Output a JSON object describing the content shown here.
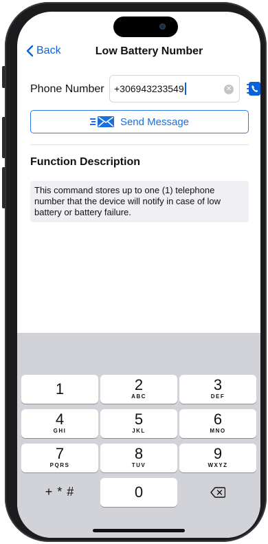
{
  "nav": {
    "back_label": "Back",
    "title": "Low Battery Number"
  },
  "phone": {
    "label": "Phone Number",
    "value": "+306943233549"
  },
  "send": {
    "label": "Send Message"
  },
  "function": {
    "title": "Function Description",
    "description": "This command stores up to one (1) telephone number that the device will notify in case of low battery or battery failure."
  },
  "keypad": {
    "keys": [
      {
        "num": "1",
        "letters": ""
      },
      {
        "num": "2",
        "letters": "ABC"
      },
      {
        "num": "3",
        "letters": "DEF"
      },
      {
        "num": "4",
        "letters": "GHI"
      },
      {
        "num": "5",
        "letters": "JKL"
      },
      {
        "num": "6",
        "letters": "MNO"
      },
      {
        "num": "7",
        "letters": "PQRS"
      },
      {
        "num": "8",
        "letters": "TUV"
      },
      {
        "num": "9",
        "letters": "WXYZ"
      },
      {
        "num": "0",
        "letters": ""
      }
    ],
    "symbols_label": "+ * #"
  },
  "colors": {
    "accent": "#0a62d9",
    "keyboard_bg": "#d2d3d9",
    "description_bg": "#efeff4"
  },
  "icons": [
    "chevron-left-icon",
    "clear-icon",
    "contact-phone-icon",
    "send-message-icon",
    "backspace-icon"
  ]
}
